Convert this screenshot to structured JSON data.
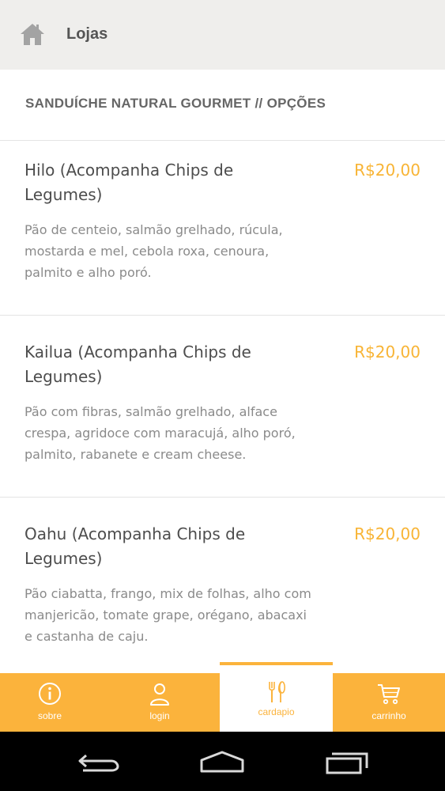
{
  "header": {
    "title": "Lojas",
    "home_icon": "home-icon"
  },
  "section": {
    "title": "SANDUÍCHE NATURAL GOURMET // OPÇÕES"
  },
  "items": [
    {
      "name": "Hilo (Acompanha Chips de Legumes)",
      "price": "R$20,00",
      "description": "Pão de centeio, salmão grelhado, rúcula, mostarda e mel, cebola roxa, cenoura, palmito e alho poró."
    },
    {
      "name": "Kailua (Acompanha Chips de Legumes)",
      "price": "R$20,00",
      "description": "Pão com fibras, salmão grelhado, alface crespa, agridoce com maracujá, alho poró, palmito, rabanete e cream cheese."
    },
    {
      "name": "Oahu (Acompanha Chips de Legumes)",
      "price": "R$20,00",
      "description": "Pão ciabatta, frango, mix de folhas, alho com manjericão, tomate grape, orégano, abacaxi e castanha de caju."
    }
  ],
  "bottom_nav": [
    {
      "label": "sobre",
      "icon": "info-icon",
      "active": false
    },
    {
      "label": "login",
      "icon": "user-icon",
      "active": false
    },
    {
      "label": "cardapio",
      "icon": "cutlery-icon",
      "active": true
    },
    {
      "label": "carrinho",
      "icon": "cart-icon",
      "active": false
    }
  ],
  "colors": {
    "accent": "#fbb33c",
    "price": "#f8b435",
    "header_bg": "#efeeec",
    "text_dark": "#4d4d4d",
    "text_muted": "#8a8a8a"
  }
}
